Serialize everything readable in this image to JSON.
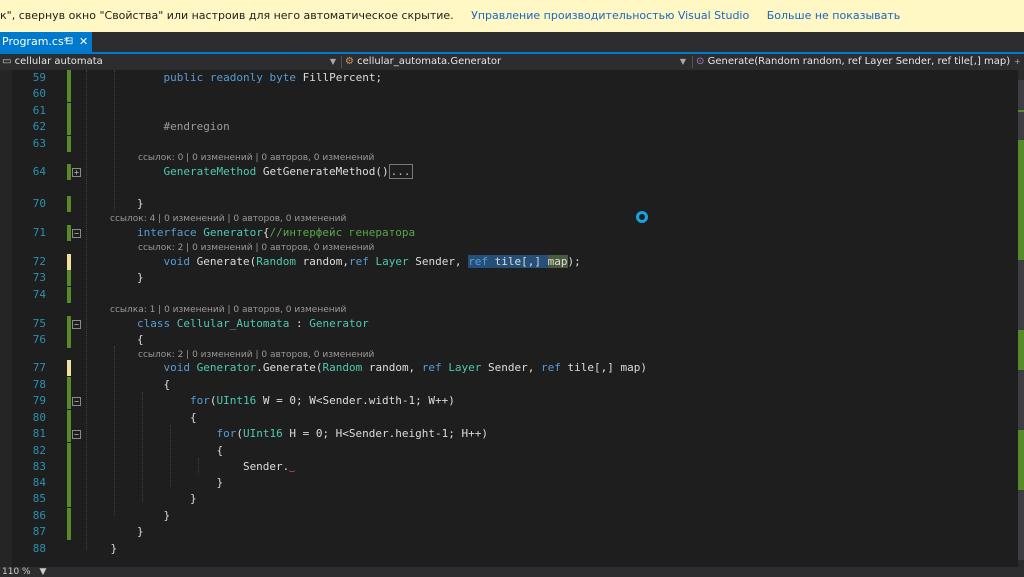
{
  "infobar": {
    "message": "к\", свернув окно \"Свойства\" или настроив для него автоматическое скрытие.",
    "link_manage": "Управление производительностью Visual Studio",
    "link_dismiss": "Больше не показывать"
  },
  "tab": {
    "name": "Program.cs*",
    "pin_icon": "pin-icon",
    "close_icon": "close-icon"
  },
  "navbar": {
    "project": "cellular automata",
    "type": "cellular_automata.Generator",
    "member": "Generate(Random random, ref Layer Sender, ref tile[,] map)"
  },
  "status": {
    "zoom": "110 %"
  },
  "lines": [
    {
      "n": "59",
      "parts": [
        [
          "",
          "            "
        ],
        [
          "kw",
          "public"
        ],
        [
          "",
          " "
        ],
        [
          "kw",
          "readonly"
        ],
        [
          "",
          " "
        ],
        [
          "kw",
          "byte"
        ],
        [
          "",
          " FillPercent;"
        ]
      ]
    },
    {
      "n": "60",
      "parts": []
    },
    {
      "n": "61",
      "parts": []
    },
    {
      "n": "62",
      "parts": [
        [
          "",
          "            "
        ],
        [
          "pp",
          "#endregion"
        ]
      ]
    },
    {
      "n": "63",
      "parts": []
    },
    {
      "n": "64",
      "parts": [
        [
          "",
          "            "
        ],
        [
          "ty",
          "GenerateMethod"
        ],
        [
          "",
          " GetGenerateMethod()"
        ],
        [
          "collapsed",
          "..."
        ]
      ]
    },
    {
      "n": "70",
      "parts": [
        [
          "",
          "        }"
        ]
      ]
    },
    {
      "n": "71",
      "parts": [
        [
          "",
          "        "
        ],
        [
          "kw",
          "interface"
        ],
        [
          "",
          " "
        ],
        [
          "ty",
          "Generator"
        ],
        [
          "",
          "{"
        ],
        [
          "cm",
          "//интерфейс генератора"
        ]
      ]
    },
    {
      "n": "72",
      "parts": [
        [
          "",
          "            "
        ],
        [
          "kw",
          "void"
        ],
        [
          "",
          " Generate("
        ],
        [
          "ty",
          "Random"
        ],
        [
          "",
          " random,"
        ],
        [
          "kw",
          "ref"
        ],
        [
          "",
          " "
        ],
        [
          "ty",
          "Layer"
        ],
        [
          "",
          " Sender, "
        ],
        [
          "sel kw",
          "ref"
        ],
        [
          "sel",
          " tile[,] "
        ],
        [
          "sel2",
          "map"
        ],
        [
          "",
          ");"
        ]
      ]
    },
    {
      "n": "73",
      "parts": [
        [
          "",
          "        }"
        ]
      ]
    },
    {
      "n": "74",
      "parts": []
    },
    {
      "n": "75",
      "parts": [
        [
          "",
          "        "
        ],
        [
          "kw",
          "class"
        ],
        [
          "",
          " "
        ],
        [
          "ty",
          "Cellular_Automata"
        ],
        [
          "",
          " : "
        ],
        [
          "ty",
          "Generator"
        ]
      ]
    },
    {
      "n": "76",
      "parts": [
        [
          "",
          "        {"
        ]
      ]
    },
    {
      "n": "77",
      "parts": [
        [
          "",
          "            "
        ],
        [
          "kw",
          "void"
        ],
        [
          "",
          " "
        ],
        [
          "ty",
          "Generator"
        ],
        [
          "",
          ".Generate("
        ],
        [
          "ty",
          "Random"
        ],
        [
          "",
          " random, "
        ],
        [
          "kw",
          "ref"
        ],
        [
          "",
          " "
        ],
        [
          "ty",
          "Layer"
        ],
        [
          "",
          " Sender, "
        ],
        [
          "kw",
          "ref"
        ],
        [
          "",
          " tile[,] map)"
        ]
      ]
    },
    {
      "n": "78",
      "parts": [
        [
          "",
          "            {"
        ]
      ]
    },
    {
      "n": "79",
      "parts": [
        [
          "",
          "                "
        ],
        [
          "kw",
          "for"
        ],
        [
          "",
          "("
        ],
        [
          "ty",
          "UInt16"
        ],
        [
          "",
          " W = 0; W<Sender.width-1; W++)"
        ]
      ]
    },
    {
      "n": "80",
      "parts": [
        [
          "",
          "                {"
        ]
      ]
    },
    {
      "n": "81",
      "parts": [
        [
          "",
          "                    "
        ],
        [
          "kw",
          "for"
        ],
        [
          "",
          "("
        ],
        [
          "ty",
          "UInt16"
        ],
        [
          "",
          " H = 0; H<Sender.height-1; H++)"
        ]
      ]
    },
    {
      "n": "82",
      "parts": [
        [
          "",
          "                    {"
        ]
      ]
    },
    {
      "n": "83",
      "parts": [
        [
          "",
          "                        Sender."
        ]
      ]
    },
    {
      "n": "84",
      "parts": [
        [
          "",
          "                    }"
        ]
      ]
    },
    {
      "n": "85",
      "parts": [
        [
          "",
          "                }"
        ]
      ]
    },
    {
      "n": "86",
      "parts": [
        [
          "",
          "            }"
        ]
      ]
    },
    {
      "n": "87",
      "parts": [
        [
          "",
          "        }"
        ]
      ]
    },
    {
      "n": "88",
      "parts": [
        [
          "",
          "    }"
        ]
      ]
    }
  ],
  "codelens": {
    "64": "ссылок: 0 | 0 изменений | 0 авторов, 0 изменений",
    "71": "ссылок: 4 | 0 изменений | 0 авторов, 0 изменений",
    "72": "ссылок: 2 | 0 изменений | 0 авторов, 0 изменений",
    "75": "ссылка: 1 | 0 изменений | 0 авторов, 0 изменений",
    "77": "ссылок: 2 | 0 изменений | 0 авторов, 0 изменений"
  },
  "foldable": [
    "64",
    "71",
    "75",
    "79",
    "81"
  ],
  "changed_yellow": [
    "72",
    "77"
  ],
  "changed_green": [
    "59",
    "60",
    "61",
    "62",
    "63",
    "64",
    "70",
    "71",
    "73",
    "74",
    "75",
    "76",
    "78",
    "79",
    "80",
    "81",
    "82",
    "83",
    "84",
    "85",
    "86",
    "87"
  ],
  "colors": {
    "accent": "#007acc",
    "keyword": "#569cd6",
    "type": "#4ec9b0",
    "comment": "#57a64a",
    "line_number": "#2b91af"
  }
}
